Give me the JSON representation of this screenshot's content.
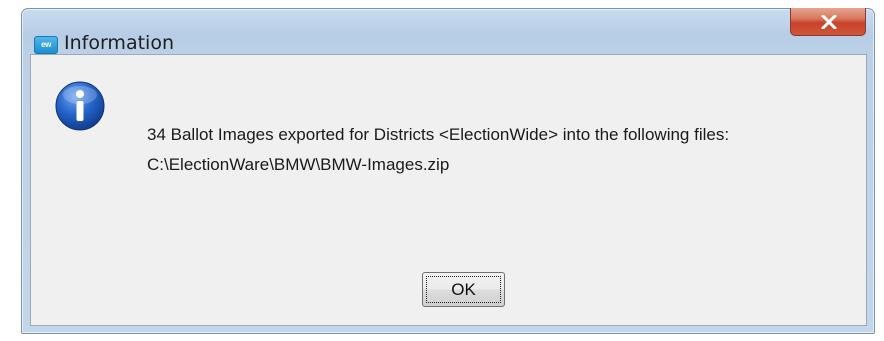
{
  "window": {
    "title": "Information",
    "app_icon_text": "ew",
    "close_icon": "close-icon"
  },
  "dialog": {
    "icon": "info-icon",
    "message_line1": "34 Ballot Images exported for Districts <ElectionWide> into the following files:",
    "message_line2": "C:\\ElectionWare\\BMW\\BMW-Images.zip",
    "ok_label": "OK"
  },
  "colors": {
    "title_bar": "#bcd1e8",
    "close_button": "#c7432a",
    "dialog_background": "#f0f0f0",
    "info_icon": "#1f5fbf"
  }
}
